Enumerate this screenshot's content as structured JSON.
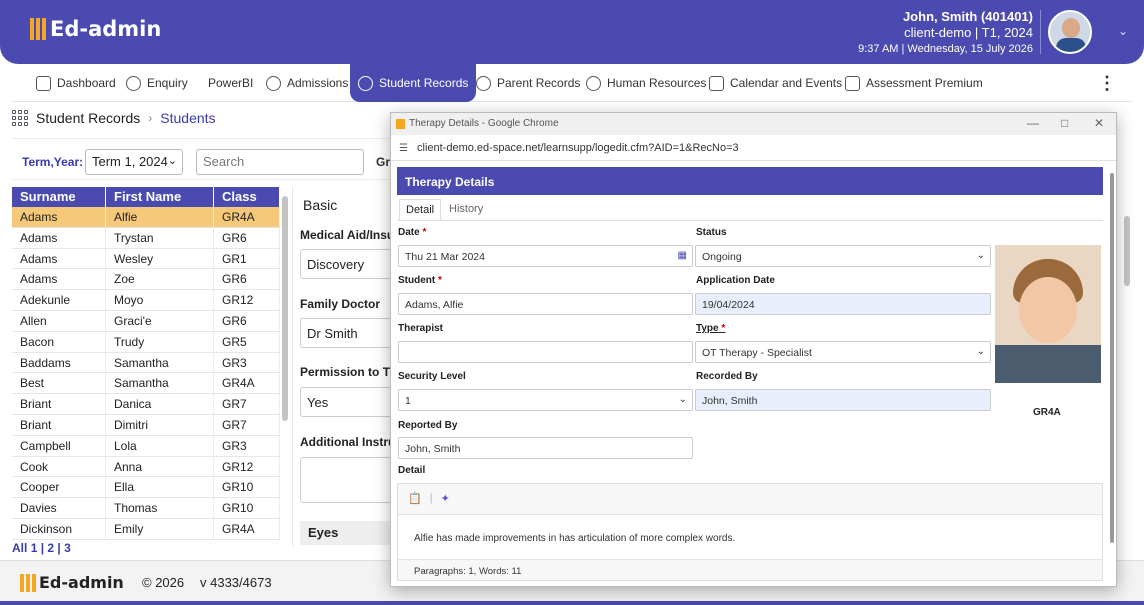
{
  "header": {
    "logo_text": "Ed-admin",
    "user_name": "John, Smith (401401)",
    "client": "client-demo  |  T1, 2024",
    "datetime": "9:37 AM  |  Wednesday, 15 July 2026",
    "bg_color": "#4a4ab0",
    "accent_color": "#f5a623"
  },
  "nav": {
    "items": [
      {
        "label": "Dashboard",
        "icon": "dashboard-icon"
      },
      {
        "label": "Enquiry",
        "icon": "question-icon"
      },
      {
        "label": "PowerBI",
        "icon": ""
      },
      {
        "label": "Admissions",
        "icon": "users-icon"
      },
      {
        "label": "Student Records",
        "icon": "student-icon"
      },
      {
        "label": "Parent Records",
        "icon": "parent-icon"
      },
      {
        "label": "Human Resources",
        "icon": "hr-icon"
      },
      {
        "label": "Calendar and Events",
        "icon": "calendar-icon"
      },
      {
        "label": "Assessment Premium",
        "icon": "assessment-icon"
      }
    ],
    "active": "Student Records"
  },
  "breadcrumb": {
    "root": "Student Records",
    "current": "Students"
  },
  "filters": {
    "term_label": "Term,Year:",
    "term_value": "Term 1, 2024",
    "search_placeholder": "Search",
    "cut_label": "Gr"
  },
  "students": {
    "columns": [
      "Surname",
      "First Name",
      "Class"
    ],
    "rows": [
      [
        "Adams",
        "Alfie",
        "GR4A"
      ],
      [
        "Adams",
        "Trystan",
        "GR6"
      ],
      [
        "Adams",
        "Wesley",
        "GR1"
      ],
      [
        "Adams",
        "Zoe",
        "GR6"
      ],
      [
        "Adekunle",
        "Moyo",
        "GR12"
      ],
      [
        "Allen",
        "Graci'e",
        "GR6"
      ],
      [
        "Bacon",
        "Trudy",
        "GR5"
      ],
      [
        "Baddams",
        "Samantha",
        "GR3"
      ],
      [
        "Best",
        "Samantha",
        "GR4A"
      ],
      [
        "Briant",
        "Danica",
        "GR7"
      ],
      [
        "Briant",
        "Dimitri",
        "GR7"
      ],
      [
        "Campbell",
        "Lola",
        "GR3"
      ],
      [
        "Cook",
        "Anna",
        "GR12"
      ],
      [
        "Cooper",
        "Ella",
        "GR10"
      ],
      [
        "Davies",
        "Thomas",
        "GR10"
      ],
      [
        "Dickinson",
        "Emily",
        "GR4A"
      ]
    ],
    "selected_index": 0,
    "pager": [
      "All",
      "1",
      "2",
      "3"
    ]
  },
  "basic_panel": {
    "title": "Basic",
    "medical_label": "Medical Aid/Insu",
    "medical_value": "Discovery",
    "doctor_label": "Family Doctor",
    "doctor_value": "Dr Smith",
    "permission_label": "Permission to Tr",
    "permission_value": "Yes",
    "additional_label": "Additional Instru",
    "eyes_label": "Eyes"
  },
  "footer": {
    "logo_text": "Ed-admin",
    "copyright": "© 2026",
    "version": "v 4333/4673"
  },
  "popup": {
    "window_title": "Therapy Details - Google Chrome",
    "url": "client-demo.ed-space.net/learnsupp/logedit.cfm?AID=1&RecNo=3",
    "heading": "Therapy Details",
    "tabs": [
      "Detail",
      "History"
    ],
    "active_tab": "Detail",
    "fields": {
      "date_label": "Date",
      "date_value": "Thu 21 Mar 2024",
      "status_label": "Status",
      "status_value": "Ongoing",
      "student_label": "Student",
      "student_value": "Adams, Alfie",
      "app_date_label": "Application Date",
      "app_date_value": "19/04/2024",
      "therapist_label": "Therapist",
      "therapist_value": "",
      "type_label": "Type",
      "type_value": "OT Therapy - Specialist",
      "security_label": "Security Level",
      "security_value": "1",
      "recorded_label": "Recorded By",
      "recorded_value": "John, Smith",
      "reported_label": "Reported By",
      "reported_value": "John, Smith",
      "detail_label": "Detail",
      "detail_text": "Alfie has made improvements in has articulation of more complex words.",
      "editor_status": "Paragraphs: 1, Words: 11"
    },
    "photo_class": "GR4A"
  }
}
